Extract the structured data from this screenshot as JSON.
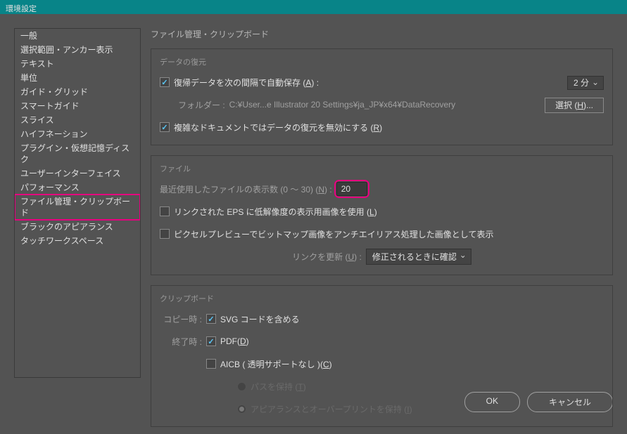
{
  "title": "環境設定",
  "sidebar": {
    "items": [
      {
        "label": "一般"
      },
      {
        "label": "選択範囲・アンカー表示"
      },
      {
        "label": "テキスト"
      },
      {
        "label": "単位"
      },
      {
        "label": "ガイド・グリッド"
      },
      {
        "label": "スマートガイド"
      },
      {
        "label": "スライス"
      },
      {
        "label": "ハイフネーション"
      },
      {
        "label": "プラグイン・仮想記憶ディスク"
      },
      {
        "label": "ユーザーインターフェイス"
      },
      {
        "label": "パフォーマンス"
      },
      {
        "label": "ファイル管理・クリップボード"
      },
      {
        "label": "ブラックのアピアランス"
      },
      {
        "label": "タッチワークスペース"
      }
    ],
    "selectedIndex": 11
  },
  "main": {
    "title": "ファイル管理・クリップボード",
    "dataRecovery": {
      "sectionTitle": "データの復元",
      "autoSave": {
        "checked": true,
        "label": "復帰データを次の間隔で自動保存 (",
        "hotkey": "A",
        "suffix": ") :"
      },
      "intervalValue": "2 分",
      "folderLabel": "フォルダー :",
      "folderPath": "C:¥User...e Illustrator 20 Settings¥ja_JP¥x64¥DataRecovery",
      "selectButton": "選択 (",
      "selectHotkey": "H",
      "selectSuffix": ")...",
      "disableComplex": {
        "checked": true,
        "label": "複雑なドキュメントではデータの復元を無効にする (",
        "hotkey": "R",
        "suffix": ")"
      }
    },
    "file": {
      "sectionTitle": "ファイル",
      "recent": {
        "label": "最近使用したファイルの表示数 (0 ～ 30) (",
        "hotkey": "N",
        "suffix": ") :",
        "value": "20"
      },
      "linkedEps": {
        "checked": false,
        "label": "リンクされた EPS に低解像度の表示用画像を使用 (",
        "hotkey": "L",
        "suffix": ")"
      },
      "pixelPreview": {
        "checked": false,
        "label": "ピクセルプレビューでビットマップ画像をアンチエイリアス処理した画像として表示"
      },
      "updateLinks": {
        "label": "リンクを更新 (",
        "hotkey": "U",
        "suffix": ") :",
        "value": "修正されるときに確認"
      }
    },
    "clipboard": {
      "sectionTitle": "クリップボード",
      "copyLabel": "コピー時 :",
      "svg": {
        "checked": true,
        "label": "SVG コードを含める"
      },
      "exitLabel": "終了時 :",
      "pdf": {
        "checked": true,
        "label": "PDF(",
        "hotkey": "D",
        "suffix": ")"
      },
      "aicb": {
        "checked": false,
        "label": "AICB ( 透明サポートなし )(",
        "hotkey": "C",
        "suffix": ")"
      },
      "keepPaths": {
        "checked": false,
        "label": "パスを保持 (",
        "hotkey": "T",
        "suffix": ")"
      },
      "keepAppearance": {
        "checked": true,
        "label": "アピアランスとオーバープリントを保持 (",
        "hotkey": "I",
        "suffix": ")"
      }
    }
  },
  "footer": {
    "ok": "OK",
    "cancel": "キャンセル"
  }
}
